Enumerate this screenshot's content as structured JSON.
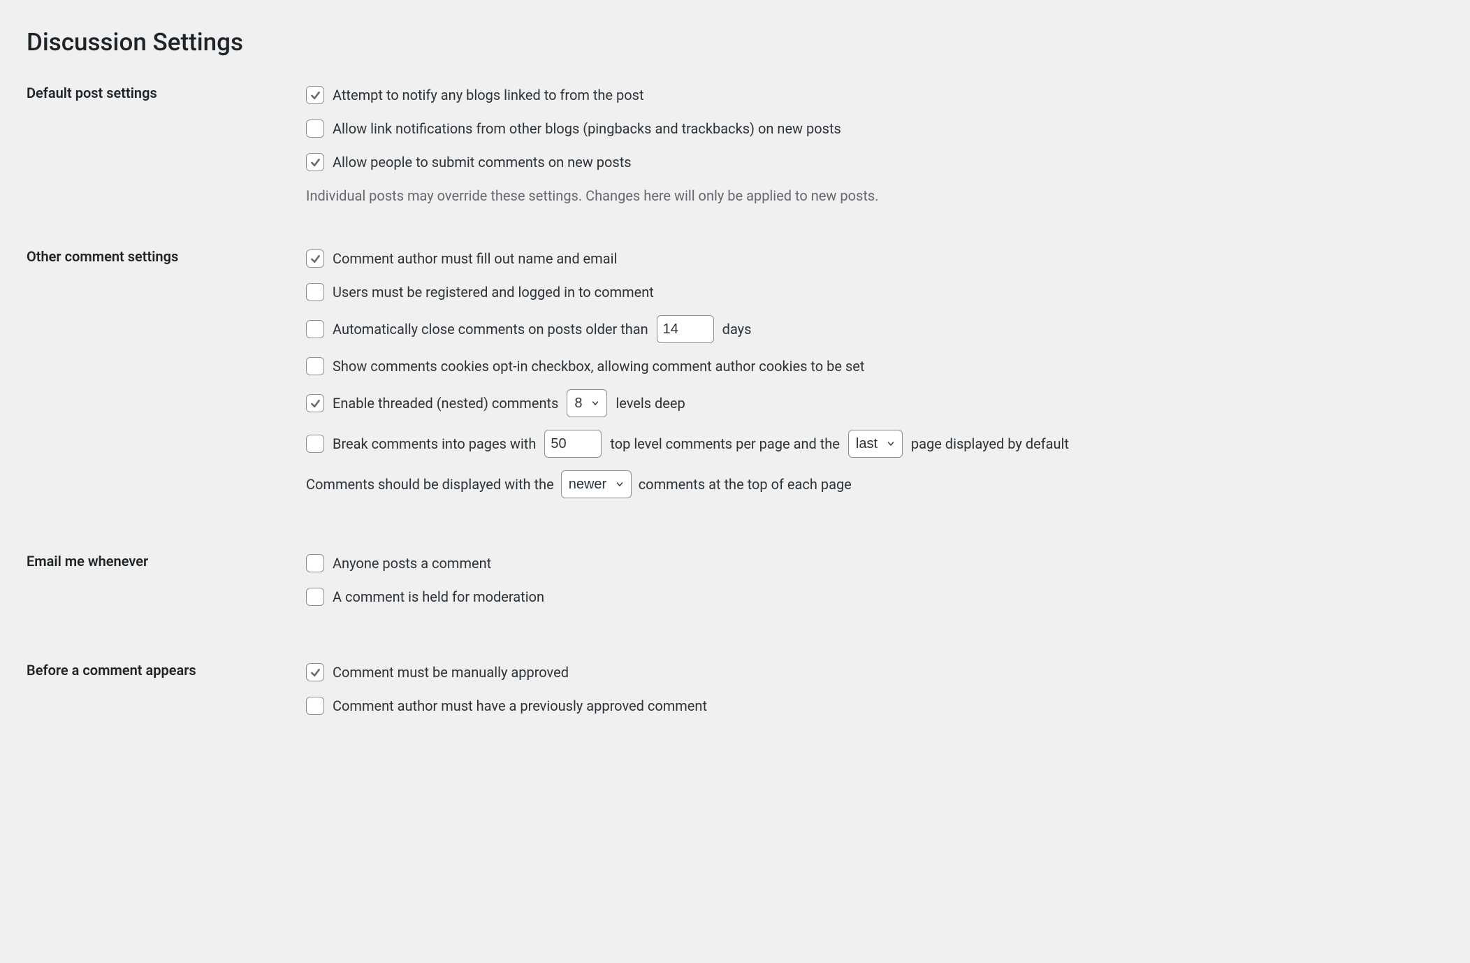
{
  "page_title": "Discussion Settings",
  "sections": {
    "default_post": {
      "heading": "Default post settings",
      "notify_linked": {
        "label": "Attempt to notify any blogs linked to from the post",
        "checked": true
      },
      "allow_pingbacks": {
        "label": "Allow link notifications from other blogs (pingbacks and trackbacks) on new posts",
        "checked": false
      },
      "allow_comments": {
        "label": "Allow people to submit comments on new posts",
        "checked": true
      },
      "description": "Individual posts may override these settings. Changes here will only be applied to new posts."
    },
    "other_comment": {
      "heading": "Other comment settings",
      "require_name_email": {
        "label": "Comment author must fill out name and email",
        "checked": true
      },
      "require_registration": {
        "label": "Users must be registered and logged in to comment",
        "checked": false
      },
      "close_old": {
        "label_before": "Automatically close comments on posts older than",
        "value": "14",
        "label_after": "days",
        "checked": false
      },
      "cookies_optin": {
        "label": "Show comments cookies opt-in checkbox, allowing comment author cookies to be set",
        "checked": false
      },
      "threaded": {
        "label_before": "Enable threaded (nested) comments",
        "value": "8",
        "label_after": "levels deep",
        "checked": true
      },
      "paginate": {
        "label_before": "Break comments into pages with",
        "per_page": "50",
        "label_mid": "top level comments per page and the",
        "default_page": "last",
        "label_after": "page displayed by default",
        "checked": false
      },
      "order": {
        "label_before": "Comments should be displayed with the",
        "value": "newer",
        "label_after": "comments at the top of each page"
      }
    },
    "email_me": {
      "heading": "Email me whenever",
      "anyone_posts": {
        "label": "Anyone posts a comment",
        "checked": false
      },
      "held_moderation": {
        "label": "A comment is held for moderation",
        "checked": false
      }
    },
    "before_appears": {
      "heading": "Before a comment appears",
      "manual_approval": {
        "label": "Comment must be manually approved",
        "checked": true
      },
      "previously_approved": {
        "label": "Comment author must have a previously approved comment",
        "checked": false
      }
    }
  }
}
